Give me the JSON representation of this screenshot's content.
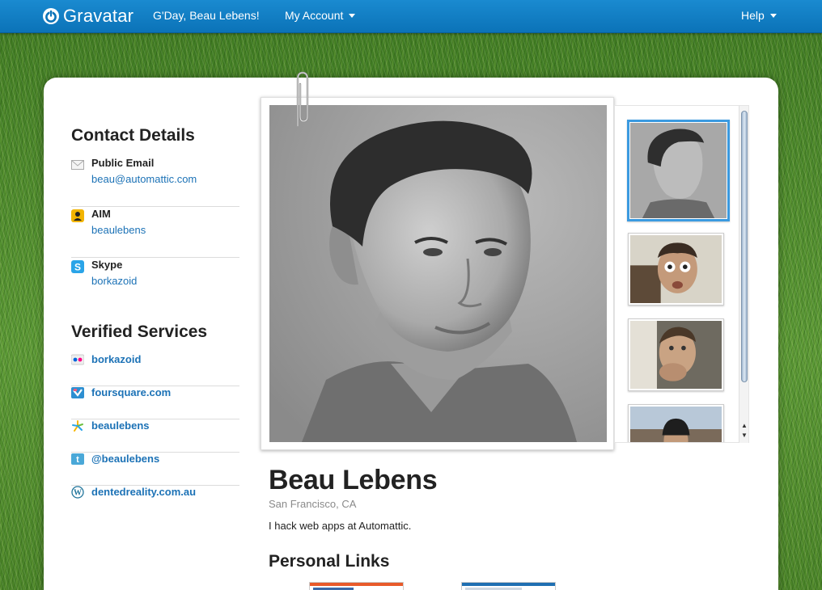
{
  "topbar": {
    "logo_text": "Gravatar",
    "greeting": "G'Day, Beau Lebens!",
    "my_account": "My Account",
    "help": "Help",
    "bar_color": "#0b73b8"
  },
  "contact": {
    "title": "Contact Details",
    "items": [
      {
        "label": "Public Email",
        "value": "beau@automattic.com",
        "icon": "email-icon"
      },
      {
        "label": "AIM",
        "value": "beaulebens",
        "icon": "aim-icon"
      },
      {
        "label": "Skype",
        "value": "borkazoid",
        "icon": "skype-icon"
      }
    ]
  },
  "services": {
    "title": "Verified Services",
    "items": [
      {
        "label": "borkazoid",
        "icon": "flickr-icon"
      },
      {
        "label": "foursquare.com",
        "icon": "foursquare-icon"
      },
      {
        "label": "beaulebens",
        "icon": "yelp-icon"
      },
      {
        "label": "@beaulebens",
        "icon": "twitter-icon"
      },
      {
        "label": "dentedreality.com.au",
        "icon": "wordpress-icon"
      }
    ]
  },
  "profile": {
    "name": "Beau Lebens",
    "location": "San Francisco, CA",
    "bio": "I hack web apps at Automattic.",
    "links_title": "Personal Links"
  },
  "colors": {
    "link": "#1c72b6",
    "accent": "#3b9ae0"
  }
}
